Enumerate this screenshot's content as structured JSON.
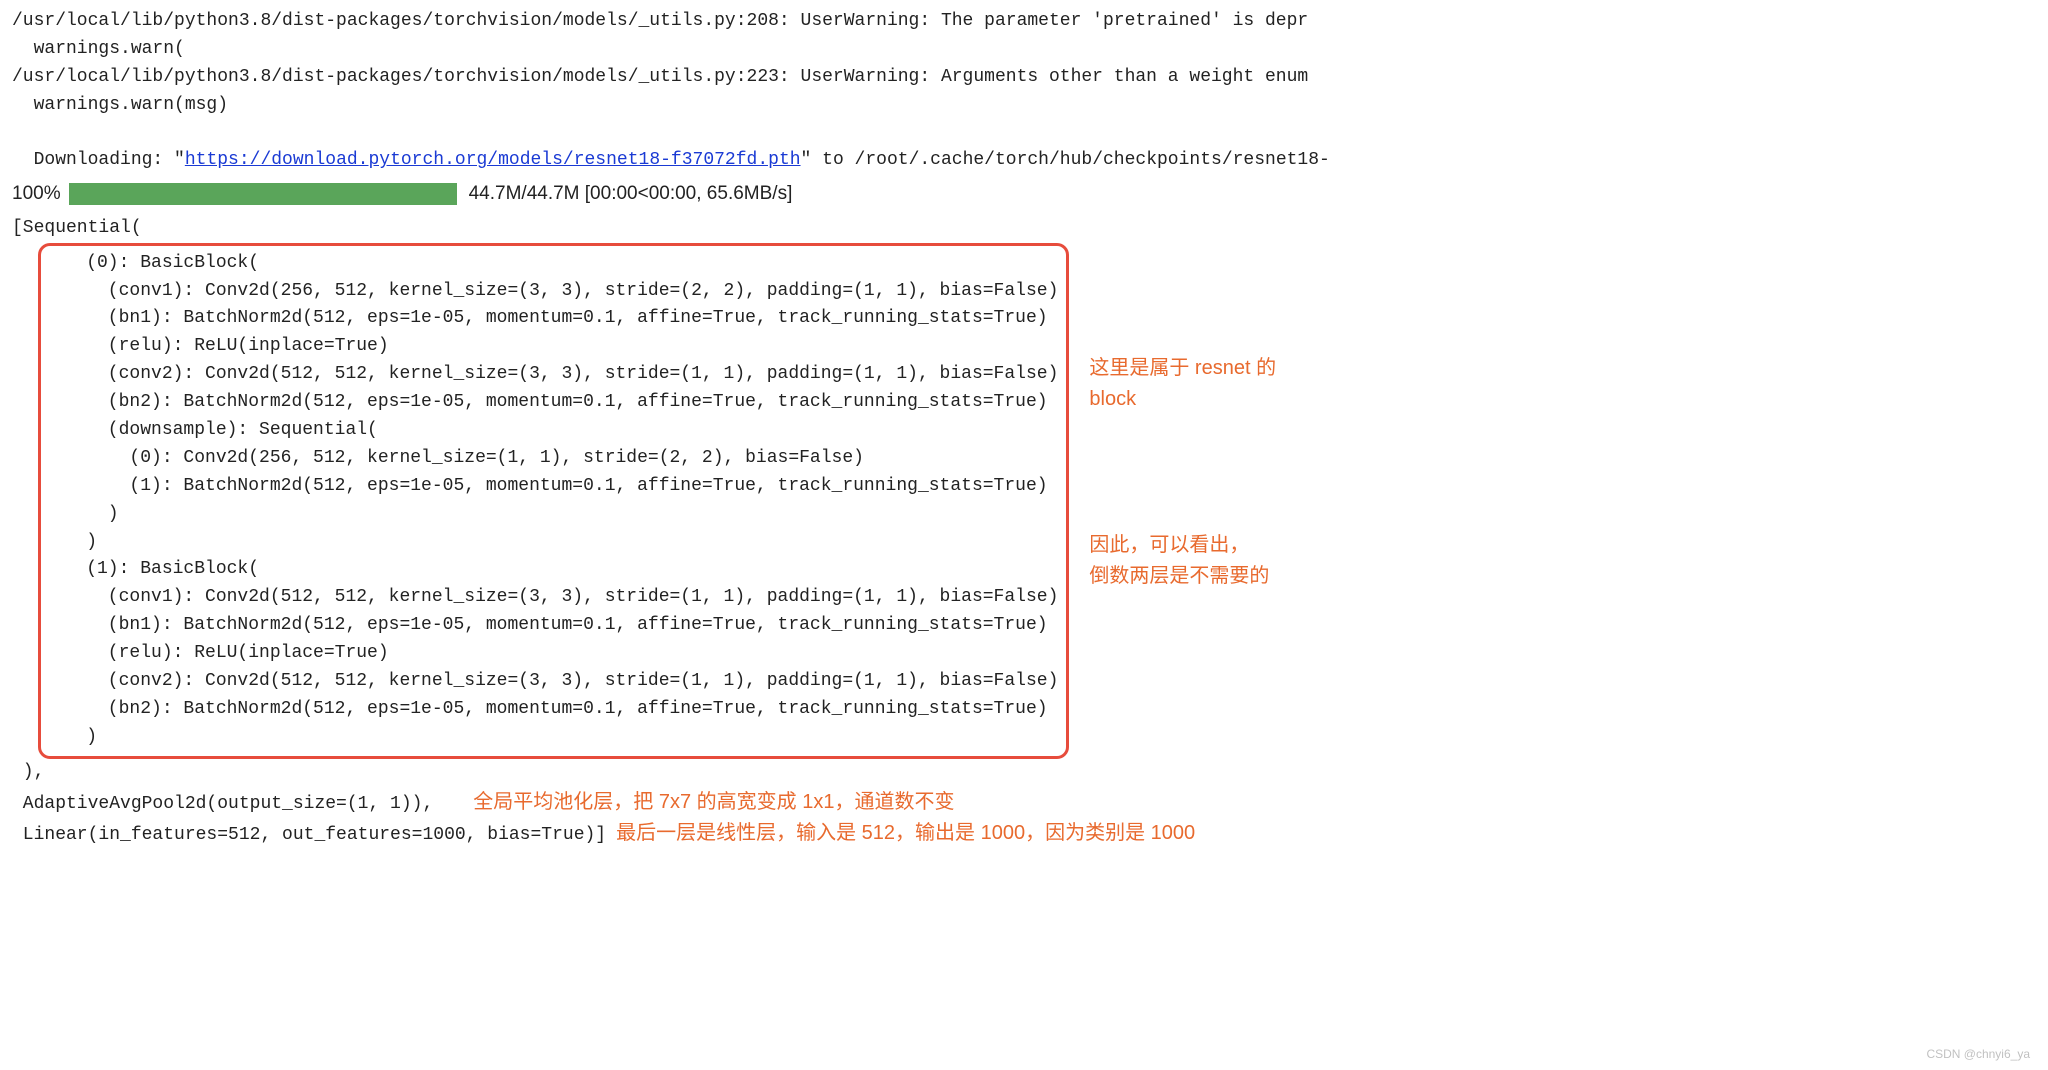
{
  "warnings": {
    "line1_path": "/usr/local/lib/python3.8/dist-packages/torchvision/models/_utils.py:208: UserWarning: The parameter 'pretrained' is depr",
    "line1_cont": "  warnings.warn(",
    "line2_path": "/usr/local/lib/python3.8/dist-packages/torchvision/models/_utils.py:223: UserWarning: Arguments other than a weight enum",
    "line2_cont": "  warnings.warn(msg)"
  },
  "download": {
    "prefix": "Downloading: \"",
    "url": "https://download.pytorch.org/models/resnet18-f37072fd.pth",
    "suffix": "\" to /root/.cache/torch/hub/checkpoints/resnet18-"
  },
  "progress": {
    "percent": "100%",
    "stats": "44.7M/44.7M [00:00<00:00, 65.6MB/s]"
  },
  "seq_open": "[Sequential(",
  "block": {
    "l0": "    (0): BasicBlock(",
    "l1": "      (conv1): Conv2d(256, 512, kernel_size=(3, 3), stride=(2, 2), padding=(1, 1), bias=False)",
    "l2": "      (bn1): BatchNorm2d(512, eps=1e-05, momentum=0.1, affine=True, track_running_stats=True)",
    "l3": "      (relu): ReLU(inplace=True)",
    "l4": "      (conv2): Conv2d(512, 512, kernel_size=(3, 3), stride=(1, 1), padding=(1, 1), bias=False)",
    "l5": "      (bn2): BatchNorm2d(512, eps=1e-05, momentum=0.1, affine=True, track_running_stats=True)",
    "l6": "      (downsample): Sequential(",
    "l7": "        (0): Conv2d(256, 512, kernel_size=(1, 1), stride=(2, 2), bias=False)",
    "l8": "        (1): BatchNorm2d(512, eps=1e-05, momentum=0.1, affine=True, track_running_stats=True)",
    "l9": "      )",
    "l10": "    )",
    "l11": "    (1): BasicBlock(",
    "l12": "      (conv1): Conv2d(512, 512, kernel_size=(3, 3), stride=(1, 1), padding=(1, 1), bias=False)",
    "l13": "      (bn1): BatchNorm2d(512, eps=1e-05, momentum=0.1, affine=True, track_running_stats=True)",
    "l14": "      (relu): ReLU(inplace=True)",
    "l15": "      (conv2): Conv2d(512, 512, kernel_size=(3, 3), stride=(1, 1), padding=(1, 1), bias=False)",
    "l16": "      (bn2): BatchNorm2d(512, eps=1e-05, momentum=0.1, affine=True, track_running_stats=True)",
    "l17": "    )"
  },
  "seq_close": " ),",
  "tail": {
    "avgpool": " AdaptiveAvgPool2d(output_size=(1, 1)),",
    "linear": " Linear(in_features=512, out_features=1000, bias=True)]"
  },
  "annotations": {
    "right1_line1": "这里是属于 resnet 的",
    "right1_line2": "block",
    "right2_line1": "因此，可以看出，",
    "right2_line2": "倒数两层是不需要的",
    "avgpool_note": "全局平均池化层，把 7x7 的高宽变成 1x1，通道数不变",
    "linear_note": "最后一层是线性层，输入是 512，输出是 1000，因为类别是 1000"
  },
  "watermark": "CSDN @chnyi6_ya"
}
